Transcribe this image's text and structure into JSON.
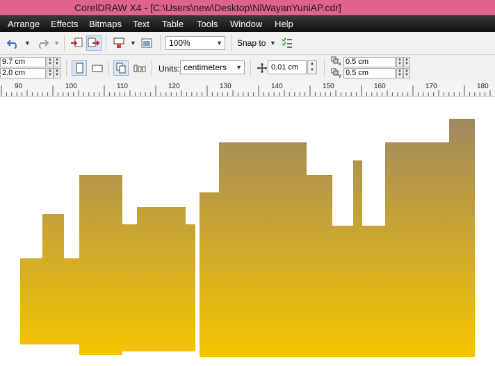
{
  "app_title": "CorelDRAW X4 - [C:\\Users\\new\\Desktop\\NiWayanYuniAP.cdr]",
  "menu": [
    "Arrange",
    "Effects",
    "Bitmaps",
    "Text",
    "Table",
    "Tools",
    "Window",
    "Help"
  ],
  "toolbar": {
    "zoom_value": "100%",
    "snap_label": "Snap to"
  },
  "property_bar": {
    "width_value": "9.7 cm",
    "height_value": "2.0 cm",
    "units_label": "Units:",
    "units_value": "centimeters",
    "nudge_value": "0.01 cm",
    "dup_x_value": "0.5 cm",
    "dup_y_value": "0.5 cm"
  },
  "ruler": {
    "labels": [
      "90",
      "100",
      "110",
      "120",
      "130",
      "140",
      "150",
      "160",
      "170",
      "180"
    ]
  },
  "drawing": {
    "gradient_top_color": "#a08860",
    "gradient_bottom_color": "#f6c500"
  },
  "icons": [
    "undo-icon",
    "redo-icon",
    "import-icon",
    "export-icon",
    "application-launcher-icon",
    "welcome-screen-icon",
    "snap-options-icon",
    "portrait-icon",
    "landscape-icon",
    "all-pages-icon",
    "current-page-icon",
    "nudge-icon",
    "duplicate-x-icon",
    "duplicate-y-icon"
  ]
}
